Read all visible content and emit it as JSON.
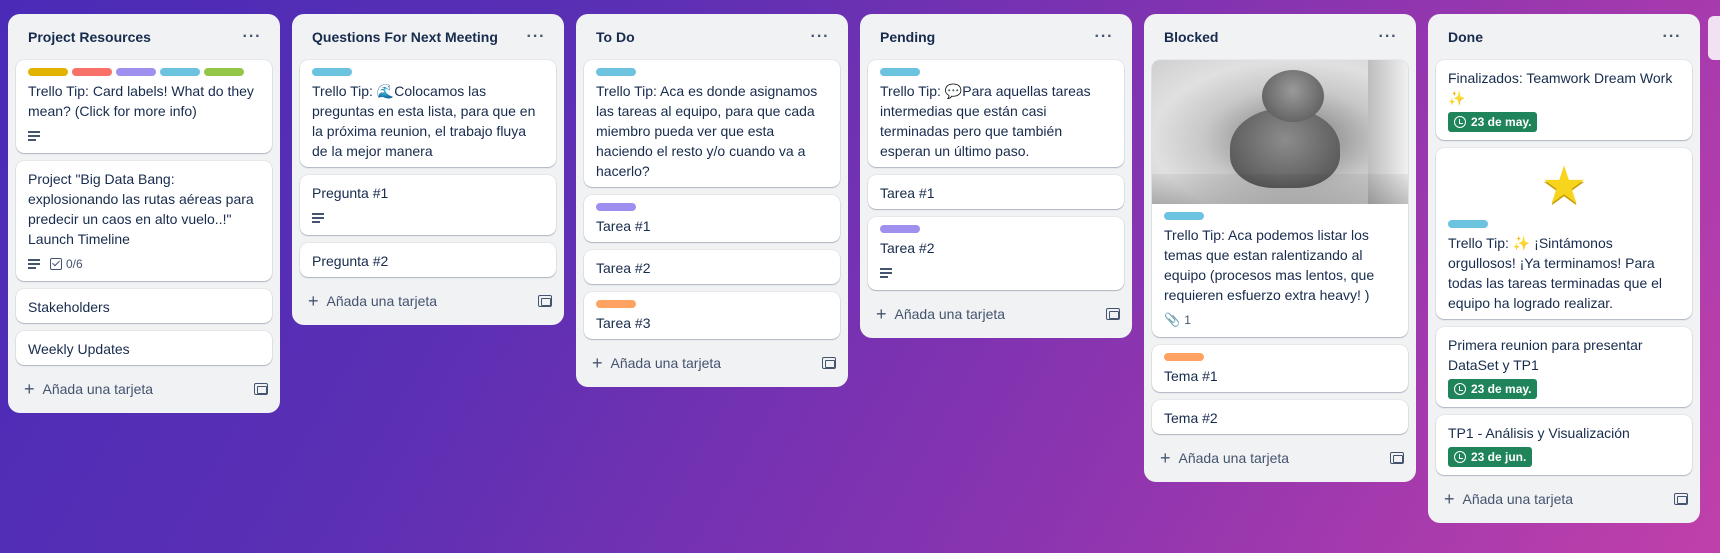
{
  "colors": {
    "label_yellow": "#e2b203",
    "label_red": "#f87168",
    "label_purple": "#9f8fef",
    "label_teal": "#6cc3e0",
    "label_green": "#94c748",
    "label_orange": "#fea362",
    "due_green": "#1f845a"
  },
  "lists": [
    {
      "title": "Project Resources",
      "menu": "···",
      "add_label": "Añada una tarjeta",
      "cards": [
        {
          "labels": [
            "label_yellow",
            "label_red",
            "label_purple",
            "label_teal",
            "label_green"
          ],
          "title": "Trello Tip: Card labels! What do they mean? (Click for more info)",
          "description_icon": "description-icon"
        },
        {
          "title": "Project \"Big Data Bang: explosionando las rutas aéreas para predecir un caos en alto vuelo..!\" Launch Timeline",
          "description_icon": "description-icon",
          "checklist": "0/6"
        },
        {
          "title": "Stakeholders"
        },
        {
          "title": "Weekly Updates"
        }
      ]
    },
    {
      "title": "Questions For Next Meeting",
      "menu": "···",
      "add_label": "Añada una tarjeta",
      "cards": [
        {
          "labels": [
            "label_teal"
          ],
          "title": "Trello Tip: 🌊Colocamos las preguntas en esta lista, para que en la próxima reunion, el trabajo fluya de la mejor manera"
        },
        {
          "title": "Pregunta #1",
          "description_icon": "description-icon"
        },
        {
          "title": "Pregunta #2"
        }
      ]
    },
    {
      "title": "To Do",
      "menu": "···",
      "add_label": "Añada una tarjeta",
      "cards": [
        {
          "labels": [
            "label_teal"
          ],
          "title": "Trello Tip: Aca es donde asignamos las tareas al equipo, para que cada miembro pueda ver que esta haciendo el resto y/o cuando va a hacerlo?"
        },
        {
          "labels": [
            "label_purple"
          ],
          "title": "Tarea #1"
        },
        {
          "title": "Tarea #2"
        },
        {
          "labels": [
            "label_orange"
          ],
          "title": "Tarea #3"
        }
      ]
    },
    {
      "title": "Pending",
      "menu": "···",
      "add_label": "Añada una tarjeta",
      "cards": [
        {
          "labels": [
            "label_teal"
          ],
          "title": "Trello Tip: 💬Para aquellas tareas intermedias que están casi terminadas pero que también esperan un último paso."
        },
        {
          "title": "Tarea #1"
        },
        {
          "labels": [
            "label_purple"
          ],
          "title": "Tarea #2",
          "description_icon": "description-icon"
        }
      ]
    },
    {
      "title": "Blocked",
      "menu": "···",
      "add_label": "Añada una tarjeta",
      "cards": [
        {
          "cover": "cat-photo",
          "labels": [
            "label_teal"
          ],
          "title": "Trello Tip: Aca podemos listar los temas que estan ralentizando al equipo (procesos mas lentos, que requieren esfuerzo extra heavy! )",
          "attachments": "1"
        },
        {
          "labels": [
            "label_orange"
          ],
          "title": "Tema #1"
        },
        {
          "title": "Tema #2"
        }
      ]
    },
    {
      "title": "Done",
      "menu": "···",
      "add_label": "Añada una tarjeta",
      "cards": [
        {
          "title": "Finalizados: Teamwork Dream Work ✨",
          "due": "23 de may."
        },
        {
          "sticker": "star",
          "labels": [
            "label_teal"
          ],
          "title": "Trello Tip: ✨ ¡Sintámonos orgullosos! ¡Ya terminamos! Para todas las tareas terminadas que el equipo ha logrado realizar."
        },
        {
          "title": "Primera reunion para presentar DataSet y TP1",
          "due": "23 de may."
        },
        {
          "title": "TP1 - Análisis y Visualización",
          "due": "23 de jun."
        }
      ]
    }
  ]
}
